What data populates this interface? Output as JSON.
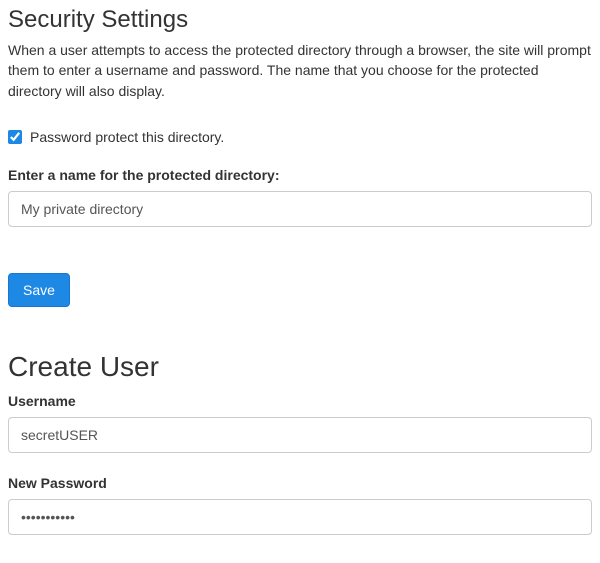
{
  "security": {
    "heading": "Security Settings",
    "description": "When a user attempts to access the protected directory through a browser, the site will prompt them to enter a username and password. The name that you choose for the protected directory will also display.",
    "checkbox_label": "Password protect this directory.",
    "checkbox_checked": true,
    "name_label": "Enter a name for the protected directory:",
    "name_value": "My private directory",
    "save_label": "Save"
  },
  "create_user": {
    "heading": "Create User",
    "username_label": "Username",
    "username_value": "secretUSER",
    "password_label": "New Password",
    "password_value": "•••••••••••"
  }
}
